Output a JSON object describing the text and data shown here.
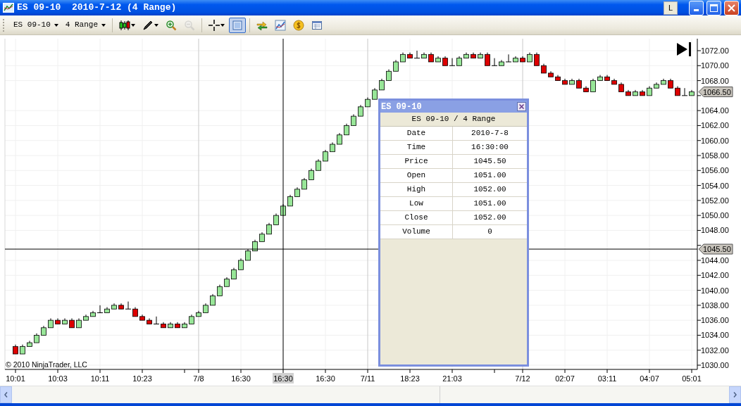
{
  "window": {
    "title": "ES 09-10  2010-7-12 (4 Range)",
    "extra_button": "L"
  },
  "toolbar": {
    "instrument": "ES 09-10",
    "interval": "4 Range",
    "tools": [
      {
        "kind": "bars",
        "selected": false,
        "disabled": false
      },
      {
        "kind": "pencil",
        "selected": false,
        "disabled": false
      },
      {
        "kind": "zoom_in",
        "selected": false,
        "disabled": false
      },
      {
        "kind": "zoom_out",
        "selected": false,
        "disabled": true
      },
      {
        "kind": "crosshair",
        "selected": false,
        "disabled": false
      },
      {
        "kind": "data_box",
        "selected": true,
        "disabled": false
      },
      {
        "kind": "instruments",
        "selected": false,
        "disabled": false
      },
      {
        "kind": "indicators",
        "selected": false,
        "disabled": false
      },
      {
        "kind": "orders",
        "selected": false,
        "disabled": false
      },
      {
        "kind": "properties",
        "selected": false,
        "disabled": false
      }
    ]
  },
  "chart": {
    "chart_data": {
      "type": "candlestick",
      "ylim": [
        1030,
        1072
      ],
      "grid": true,
      "ref_lines": [
        {
          "axis": "y",
          "value": 1045.5
        }
      ],
      "categories": [
        "10:01",
        null,
        null,
        null,
        null,
        null,
        "10:03",
        null,
        null,
        null,
        null,
        null,
        "10:11",
        null,
        null,
        null,
        null,
        null,
        "10:23",
        null,
        null,
        null,
        null,
        null,
        null,
        null,
        "7/8",
        null,
        null,
        null,
        null,
        null,
        "16:30",
        null,
        null,
        null,
        null,
        null,
        "16:30",
        null,
        null,
        null,
        null,
        null,
        "16:30",
        null,
        null,
        null,
        null,
        null,
        "7/11",
        null,
        null,
        null,
        null,
        null,
        "18:23",
        null,
        null,
        null,
        null,
        null,
        "21:03",
        null,
        null,
        null,
        null,
        null,
        null,
        null,
        null,
        null,
        "7/12",
        null,
        null,
        null,
        null,
        null,
        "02:07",
        null,
        null,
        null,
        null,
        null,
        "03:11",
        null,
        null,
        null,
        null,
        null,
        "04:07",
        null,
        null,
        null,
        null,
        null,
        "05:01"
      ],
      "yticks": [
        {
          "value": 1072,
          "label": "1072.00"
        },
        {
          "value": 1070,
          "label": "1070.00"
        },
        {
          "value": 1068,
          "label": "1068.00"
        },
        {
          "value": 1064,
          "label": "1064.00"
        },
        {
          "value": 1062,
          "label": "1062.00"
        },
        {
          "value": 1060,
          "label": "1060.00"
        },
        {
          "value": 1058,
          "label": "1058.00"
        },
        {
          "value": 1056,
          "label": "1056.00"
        },
        {
          "value": 1054,
          "label": "1054.00"
        },
        {
          "value": 1052,
          "label": "1052.00"
        },
        {
          "value": 1050,
          "label": "1050.00"
        },
        {
          "value": 1048,
          "label": "1048.00"
        },
        {
          "value": 1044,
          "label": "1044.00"
        },
        {
          "value": 1042,
          "label": "1042.00"
        },
        {
          "value": 1040,
          "label": "1040.00"
        },
        {
          "value": 1038,
          "label": "1038.00"
        },
        {
          "value": 1036,
          "label": "1036.00"
        },
        {
          "value": 1034,
          "label": "1034.00"
        },
        {
          "value": 1032,
          "label": "1032.00"
        },
        {
          "value": 1030,
          "label": "1030.00"
        }
      ],
      "ohlc": [
        [
          1032.5,
          1032.75,
          1031.5,
          1031.5
        ],
        [
          1031.5,
          1032.75,
          1031.5,
          1032.5
        ],
        [
          1032.5,
          1033.25,
          1032.5,
          1033
        ],
        [
          1033,
          1034.25,
          1033,
          1034
        ],
        [
          1034,
          1035.25,
          1034,
          1035
        ],
        [
          1035,
          1036.25,
          1035,
          1036
        ],
        [
          1036,
          1036.25,
          1035.5,
          1035.5
        ],
        [
          1035.5,
          1036.25,
          1035.5,
          1036
        ],
        [
          1036,
          1036.25,
          1035,
          1035
        ],
        [
          1035,
          1036.25,
          1035,
          1036
        ],
        [
          1036,
          1036.75,
          1036,
          1036.5
        ],
        [
          1036.5,
          1037.25,
          1036.5,
          1037
        ],
        [
          1037,
          1038,
          1037,
          1037
        ],
        [
          1037,
          1037.75,
          1037,
          1037.5
        ],
        [
          1037.5,
          1038.25,
          1037.5,
          1038
        ],
        [
          1038,
          1038.25,
          1037.5,
          1037.5
        ],
        [
          1037.5,
          1038.5,
          1037.5,
          1037.5
        ],
        [
          1037.5,
          1037.75,
          1036.5,
          1036.5
        ],
        [
          1036.5,
          1036.75,
          1036,
          1036
        ],
        [
          1036,
          1036.25,
          1035.5,
          1035.5
        ],
        [
          1035.5,
          1036.5,
          1035.5,
          1035.5
        ],
        [
          1035.5,
          1035.75,
          1035,
          1035
        ],
        [
          1035,
          1035.75,
          1035,
          1035.5
        ],
        [
          1035.5,
          1035.75,
          1035,
          1035
        ],
        [
          1035,
          1035.75,
          1035,
          1035.5
        ],
        [
          1035.5,
          1036.75,
          1035.5,
          1036.5
        ],
        [
          1036.5,
          1037.25,
          1036.5,
          1037
        ],
        [
          1037,
          1038.25,
          1037,
          1038
        ],
        [
          1038,
          1039.5,
          1038,
          1039.25
        ],
        [
          1039.25,
          1040.75,
          1039.25,
          1040.5
        ],
        [
          1040.5,
          1041.75,
          1040.5,
          1041.5
        ],
        [
          1041.5,
          1043,
          1041.5,
          1042.75
        ],
        [
          1042.75,
          1044.25,
          1042.75,
          1044
        ],
        [
          1044,
          1045.5,
          1044,
          1045.25
        ],
        [
          1045.25,
          1046.75,
          1045.25,
          1046.5
        ],
        [
          1046.5,
          1047.75,
          1046.5,
          1047.5
        ],
        [
          1047.5,
          1049,
          1047.5,
          1048.75
        ],
        [
          1048.75,
          1050.25,
          1048.75,
          1050
        ],
        [
          1050,
          1051.5,
          1050,
          1051.25
        ],
        [
          1051.25,
          1052.75,
          1051.25,
          1052.5
        ],
        [
          1052.5,
          1053.75,
          1052.5,
          1053.5
        ],
        [
          1053.5,
          1055,
          1053.5,
          1054.75
        ],
        [
          1054.75,
          1056.25,
          1054.75,
          1056
        ],
        [
          1056,
          1057.5,
          1056,
          1057.25
        ],
        [
          1057.25,
          1058.75,
          1057.25,
          1058.5
        ],
        [
          1058.5,
          1059.75,
          1058.5,
          1059.5
        ],
        [
          1059.5,
          1061,
          1059.5,
          1060.75
        ],
        [
          1060.75,
          1062.25,
          1060.75,
          1062
        ],
        [
          1062,
          1063.5,
          1062,
          1063.25
        ],
        [
          1063.25,
          1064.75,
          1063.25,
          1064.5
        ],
        [
          1064.5,
          1065.75,
          1064.5,
          1065.5
        ],
        [
          1065.5,
          1067,
          1065.5,
          1066.75
        ],
        [
          1066.75,
          1068.25,
          1066.75,
          1068
        ],
        [
          1068,
          1069.5,
          1068,
          1069.25
        ],
        [
          1069.25,
          1070.75,
          1069.25,
          1070.5
        ],
        [
          1070.5,
          1071.75,
          1070.5,
          1071.5
        ],
        [
          1071.5,
          1071.75,
          1071,
          1071
        ],
        [
          1071,
          1072,
          1071,
          1071
        ],
        [
          1071,
          1071.75,
          1071,
          1071.5
        ],
        [
          1071.5,
          1071.75,
          1070.5,
          1070.5
        ],
        [
          1070.5,
          1071.25,
          1070.5,
          1071
        ],
        [
          1071,
          1071.25,
          1070,
          1070
        ],
        [
          1070,
          1071,
          1070,
          1070
        ],
        [
          1070,
          1071.25,
          1070,
          1071
        ],
        [
          1071,
          1071.75,
          1071,
          1071.5
        ],
        [
          1071.5,
          1071.75,
          1071,
          1071
        ],
        [
          1071,
          1071.75,
          1071,
          1071.5
        ],
        [
          1071.5,
          1071.75,
          1070,
          1070
        ],
        [
          1070,
          1071,
          1070,
          1070
        ],
        [
          1070,
          1070.75,
          1070,
          1070.5
        ],
        [
          1070.5,
          1071.5,
          1070.5,
          1070.5
        ],
        [
          1070.5,
          1071.25,
          1070.5,
          1071
        ],
        [
          1071,
          1071.25,
          1070.5,
          1070.5
        ],
        [
          1070.5,
          1071.75,
          1070.5,
          1071.5
        ],
        [
          1071.5,
          1071.75,
          1070,
          1070
        ],
        [
          1070,
          1070.25,
          1069,
          1069
        ],
        [
          1069,
          1069.25,
          1068.5,
          1068.5
        ],
        [
          1068.5,
          1068.75,
          1068,
          1068
        ],
        [
          1068,
          1068.25,
          1067.5,
          1067.5
        ],
        [
          1067.5,
          1068.25,
          1067.5,
          1068
        ],
        [
          1068,
          1068.25,
          1067,
          1067
        ],
        [
          1067,
          1067.25,
          1066.5,
          1066.5
        ],
        [
          1066.5,
          1068.25,
          1066.5,
          1068
        ],
        [
          1068,
          1068.75,
          1068,
          1068.5
        ],
        [
          1068.5,
          1068.75,
          1068,
          1068
        ],
        [
          1068,
          1068.25,
          1067.5,
          1067.5
        ],
        [
          1067.5,
          1067.75,
          1066.5,
          1066.5
        ],
        [
          1066.5,
          1066.75,
          1066,
          1066
        ],
        [
          1066,
          1066.75,
          1066,
          1066.5
        ],
        [
          1066.5,
          1066.75,
          1066,
          1066
        ],
        [
          1066,
          1067.25,
          1066,
          1067
        ],
        [
          1067,
          1067.75,
          1067,
          1067.5
        ],
        [
          1067.5,
          1068.25,
          1067.5,
          1068
        ],
        [
          1068,
          1068.25,
          1067,
          1067
        ],
        [
          1067,
          1067.25,
          1066,
          1066
        ],
        [
          1066,
          1067,
          1066,
          1066
        ],
        [
          1066,
          1066.75,
          1066,
          1066.5
        ]
      ]
    },
    "crosshair": {
      "visible": true
    },
    "price_tags": [
      "1066.50",
      "1045.50"
    ],
    "copyright": "© 2010 NinjaTrader, LLC",
    "data_box": {
      "title": "ES 09-10",
      "header": "ES 09-10 / 4 Range",
      "rows": [
        {
          "label": "Date",
          "value": "2010-7-8"
        },
        {
          "label": "Time",
          "value": "16:30:00"
        },
        {
          "label": "Price",
          "value": "1045.50"
        },
        {
          "label": "Open",
          "value": "1051.00"
        },
        {
          "label": "High",
          "value": "1052.00"
        },
        {
          "label": "Low",
          "value": "1051.00"
        },
        {
          "label": "Close",
          "value": "1052.00"
        },
        {
          "label": "Volume",
          "value": "0"
        }
      ]
    }
  }
}
